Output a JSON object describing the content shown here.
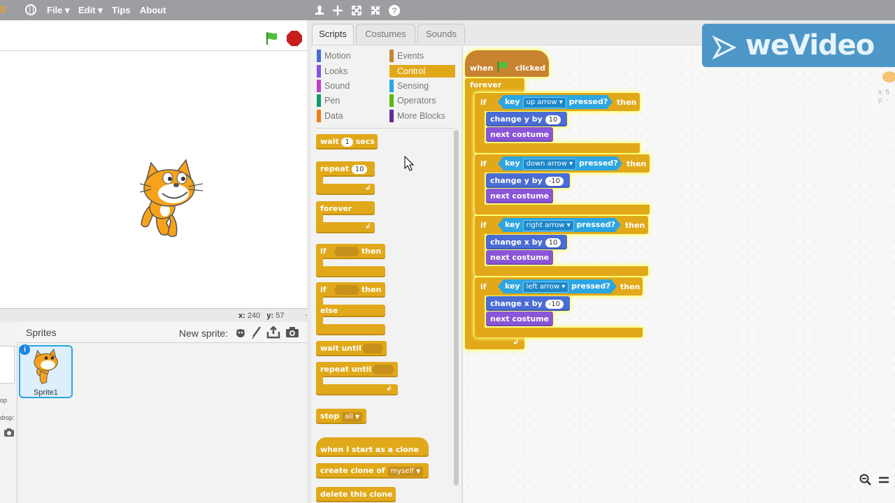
{
  "menubar": {
    "logo": "S",
    "items": [
      "File",
      "Edit",
      "Tips",
      "About"
    ],
    "file_label": "File ▾",
    "edit_label": "Edit ▾",
    "tips_label": "Tips",
    "about_label": "About",
    "toolbar_icons": [
      "duplicate-stamp-icon",
      "cut-icon",
      "grow-icon",
      "shrink-icon",
      "help-icon"
    ]
  },
  "stage": {
    "coords": {
      "x_label": "x:",
      "x_value": "240",
      "y_label": "y:",
      "y_value": "57"
    }
  },
  "tabs": {
    "scripts": "Scripts",
    "costumes": "Costumes",
    "sounds": "Sounds"
  },
  "categories": {
    "motion": "Motion",
    "looks": "Looks",
    "sound": "Sound",
    "pen": "Pen",
    "data": "Data",
    "events": "Events",
    "control": "Control",
    "sensing": "Sensing",
    "operators": "Operators",
    "more": "More Blocks"
  },
  "category_colors": {
    "motion": "#4a6cd4",
    "looks": "#8a55d7",
    "sound": "#bb42c3",
    "pen": "#0e9a6c",
    "data": "#ee7d16",
    "events": "#c88330",
    "control": "#e1a91a",
    "sensing": "#2ca5e2",
    "operators": "#5cb712",
    "more": "#632d99"
  },
  "palette_blocks": {
    "wait": "wait",
    "wait_num": "1",
    "wait_secs": "secs",
    "repeat": "repeat",
    "repeat_num": "10",
    "forever": "forever",
    "if1": "if",
    "if1_then": "then",
    "if2": "if",
    "if2_then": "then",
    "else": "else",
    "wait_until": "wait until",
    "repeat_until": "repeat until",
    "stop": "stop",
    "stop_opt": "all",
    "clone_hat": "when I start as a clone",
    "create_clone": "create clone of",
    "create_clone_opt": "myself",
    "delete_clone": "delete this clone"
  },
  "script": {
    "hat_when": "when",
    "hat_clicked": "clicked",
    "forever": "forever",
    "rows": [
      {
        "if": "if",
        "key": "key",
        "key_opt": "up arrow",
        "pressed": "pressed?",
        "then": "then",
        "change": "change y by",
        "value": "10",
        "next": "next costume"
      },
      {
        "if": "if",
        "key": "key",
        "key_opt": "down arrow",
        "pressed": "pressed?",
        "then": "then",
        "change": "change y by",
        "value": "-10",
        "next": "next costume"
      },
      {
        "if": "if",
        "key": "key",
        "key_opt": "right arrow",
        "pressed": "pressed?",
        "then": "then",
        "change": "change x by",
        "value": "10",
        "next": "next costume"
      },
      {
        "if": "if",
        "key": "key",
        "key_opt": "left arrow",
        "pressed": "pressed?",
        "then": "then",
        "change": "change x by",
        "value": "-10",
        "next": "next costume"
      }
    ]
  },
  "sprites": {
    "title": "Sprites",
    "new_sprite": "New sprite:",
    "sprite1": "Sprite1",
    "info": "i"
  },
  "side": {
    "op": "op",
    "drop": "drop:"
  },
  "watermark": {
    "text": "weVideo"
  },
  "sprite_info": {
    "x": "x: 5",
    "y": "y: -"
  }
}
